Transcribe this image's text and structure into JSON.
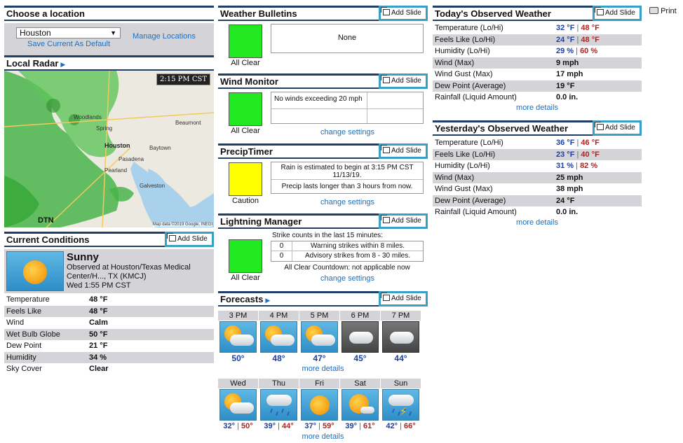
{
  "print_label": "Print",
  "add_slide_label": "Add Slide",
  "location": {
    "title": "Choose a location",
    "selected": "Houston",
    "save_default": "Save Current As Default",
    "manage": "Manage Locations"
  },
  "radar": {
    "title": "Local Radar",
    "time": "2:15 PM CST",
    "credit": "Map data ©2019 Google, INEGI",
    "brand": "DTN",
    "places": [
      "Woodlands",
      "Spring",
      "Beaumont",
      "Houston",
      "Baytown",
      "Pasadena",
      "Pearland",
      "Galveston"
    ]
  },
  "current": {
    "title": "Current Conditions",
    "condition": "Sunny",
    "observed": "Observed at Houston/Texas Medical Center/H..., TX (KMCJ)",
    "time": "Wed 1:55 PM CST",
    "rows": [
      {
        "label": "Temperature",
        "value": "48 °F"
      },
      {
        "label": "Feels Like",
        "value": "48 °F"
      },
      {
        "label": "Wind",
        "value": "Calm"
      },
      {
        "label": "Wet Bulb Globe",
        "value": "50 °F"
      },
      {
        "label": "Dew Point",
        "value": "21 °F"
      },
      {
        "label": "Humidity",
        "value": "34 %"
      },
      {
        "label": "Sky Cover",
        "value": "Clear"
      }
    ]
  },
  "bulletins": {
    "title": "Weather Bulletins",
    "status": "All Clear",
    "message": "None",
    "color": "#22e822"
  },
  "wind": {
    "title": "Wind Monitor",
    "status": "All Clear",
    "message": "No winds exceeding 20 mph",
    "settings": "change settings",
    "color": "#22e822"
  },
  "precip": {
    "title": "PrecipTimer",
    "status": "Caution",
    "color": "#ffff00",
    "line1": "Rain is estimated to begin at 3:15 PM CST 11/13/19.",
    "line2": "Precip lasts longer than 3 hours from now.",
    "settings": "change settings"
  },
  "lightning": {
    "title": "Lightning Manager",
    "status": "All Clear",
    "color": "#22e822",
    "heading": "Strike counts in the last 15 minutes:",
    "rows": [
      {
        "count": "0",
        "text": "Warning strikes within 8 miles."
      },
      {
        "count": "0",
        "text": "Advisory strikes from 8 - 30 miles."
      }
    ],
    "countdown": "All Clear Countdown: not applicable now",
    "settings": "change settings"
  },
  "forecasts": {
    "title": "Forecasts",
    "hourly": [
      {
        "label": "3 PM",
        "temp": "50°",
        "icon": "partly-cloudy-icon"
      },
      {
        "label": "4 PM",
        "temp": "48°",
        "icon": "partly-cloudy-icon"
      },
      {
        "label": "5 PM",
        "temp": "47°",
        "icon": "partly-cloudy-icon"
      },
      {
        "label": "6 PM",
        "temp": "45°",
        "icon": "night-cloudy-icon"
      },
      {
        "label": "7 PM",
        "temp": "44°",
        "icon": "night-cloudy-icon"
      }
    ],
    "daily": [
      {
        "label": "Wed",
        "lo": "32°",
        "hi": "50°",
        "icon": "partly-cloudy-icon"
      },
      {
        "label": "Thu",
        "lo": "39°",
        "hi": "44°",
        "icon": "rain-icon"
      },
      {
        "label": "Fri",
        "lo": "37°",
        "hi": "59°",
        "icon": "sunny-icon"
      },
      {
        "label": "Sat",
        "lo": "39°",
        "hi": "61°",
        "icon": "mostly-sunny-icon"
      },
      {
        "label": "Sun",
        "lo": "42°",
        "hi": "66°",
        "icon": "thunderstorm-icon"
      }
    ],
    "more": "more details"
  },
  "today": {
    "title": "Today's Observed Weather",
    "rows": [
      {
        "label": "Temperature (Lo/Hi)",
        "lo": "32 °F",
        "hi": "48 °F"
      },
      {
        "label": "Feels Like (Lo/Hi)",
        "lo": "24 °F",
        "hi": "48 °F"
      },
      {
        "label": "Humidity (Lo/Hi)",
        "lo": "29 %",
        "hi": "60 %"
      },
      {
        "label": "Wind (Max)",
        "value": "9 mph"
      },
      {
        "label": "Wind Gust (Max)",
        "value": "17 mph"
      },
      {
        "label": "Dew Point (Average)",
        "value": "19 °F"
      },
      {
        "label": "Rainfall (Liquid Amount)",
        "value": "0.0 in."
      }
    ],
    "more": "more details"
  },
  "yesterday": {
    "title": "Yesterday's Observed Weather",
    "rows": [
      {
        "label": "Temperature (Lo/Hi)",
        "lo": "36 °F",
        "hi": "46 °F"
      },
      {
        "label": "Feels Like (Lo/Hi)",
        "lo": "23 °F",
        "hi": "40 °F"
      },
      {
        "label": "Humidity (Lo/Hi)",
        "lo": "31 %",
        "hi": "82 %"
      },
      {
        "label": "Wind (Max)",
        "value": "25 mph"
      },
      {
        "label": "Wind Gust (Max)",
        "value": "38 mph"
      },
      {
        "label": "Dew Point (Average)",
        "value": "24 °F"
      },
      {
        "label": "Rainfall (Liquid Amount)",
        "value": "0.0 in."
      }
    ],
    "more": "more details"
  }
}
